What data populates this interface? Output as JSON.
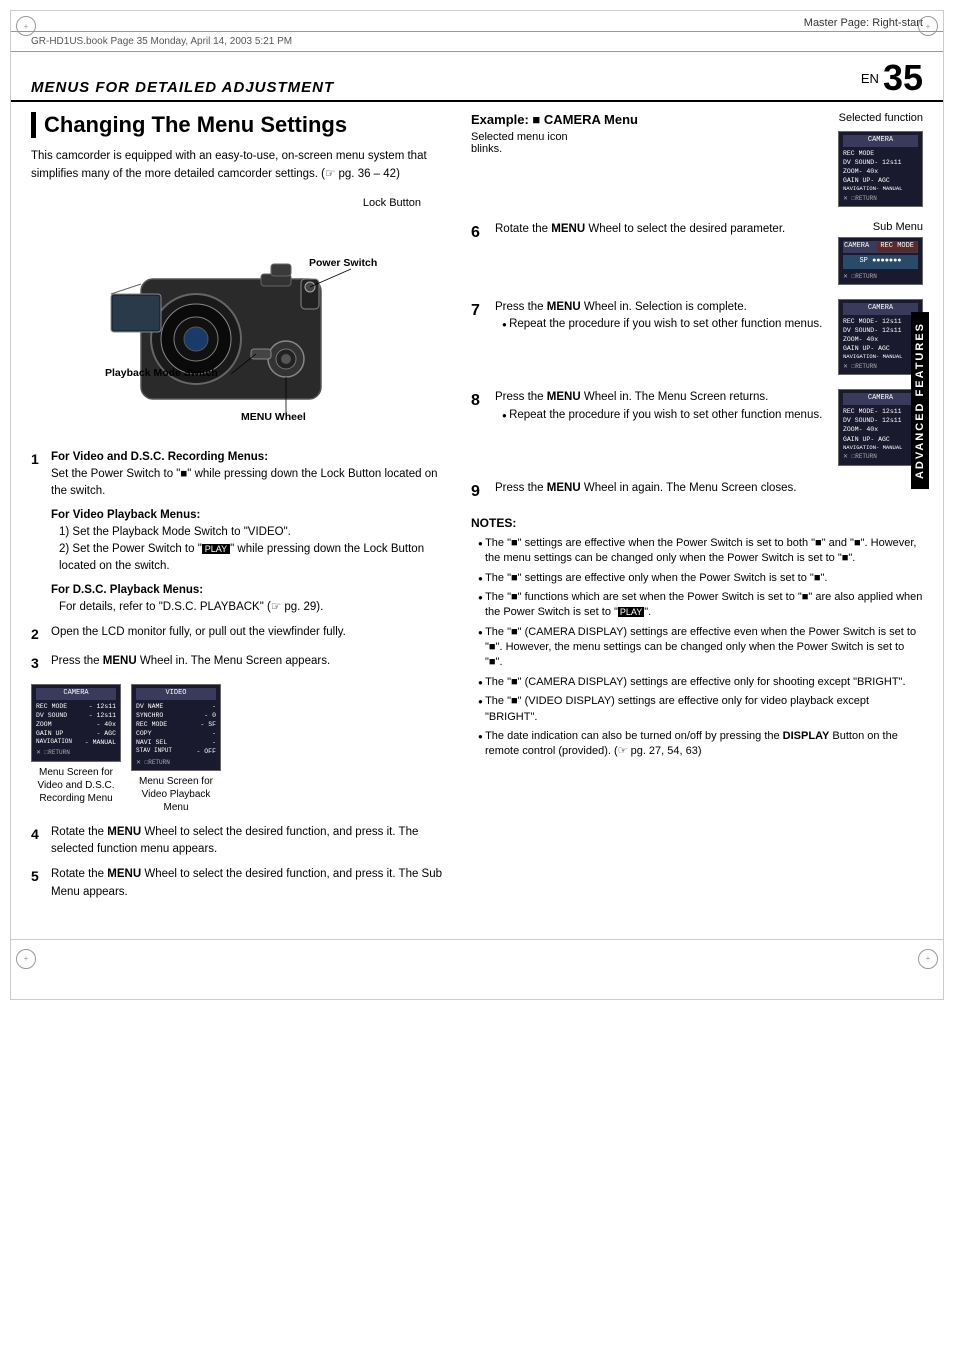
{
  "meta": {
    "master_page": "Master Page: Right-start",
    "file_info": "GR-HD1US.book  Page 35  Monday, April 14, 2003  5:21 PM"
  },
  "header": {
    "section_title": "MENUS FOR DETAILED ADJUSTMENT",
    "en_label": "EN",
    "page_number": "35"
  },
  "page": {
    "heading": "Changing The Menu Settings",
    "intro": "This camcorder is equipped with an easy-to-use, on-screen menu system that simplifies many of the more detailed camcorder settings. (☞ pg. 36 – 42)"
  },
  "camera_labels": {
    "lock_button": "Lock Button",
    "power_switch": "Power Switch",
    "playback_mode": "Playback Mode Switch",
    "menu_wheel": "MENU Wheel"
  },
  "steps": [
    {
      "num": "1",
      "title": "For Video and D.S.C. Recording Menus:",
      "text": "Set the Power Switch to \"\" while pressing down the Lock Button located on the switch.",
      "sub_steps": [
        {
          "title": "For Video Playback Menus:",
          "items": [
            "1) Set the Playback Mode Switch to \"VIDEO\".",
            "2) Set the Power Switch to \"PLAY\" while pressing down the Lock Button located on the switch."
          ]
        },
        {
          "title": "For D.S.C. Playback Menus:",
          "text": "For details, refer to \"D.S.C. PLAYBACK\" (☞ pg. 29)."
        }
      ]
    },
    {
      "num": "2",
      "text": "Open the LCD monitor fully, or pull out the viewfinder fully."
    },
    {
      "num": "3",
      "text": "Press the MENU Wheel in. The Menu Screen appears."
    },
    {
      "num": "4",
      "text": "Rotate the MENU Wheel to select the desired function, and press it. The selected function menu appears."
    },
    {
      "num": "5",
      "text": "Rotate the MENU Wheel to select the desired function, and press it. The Sub Menu appears."
    }
  ],
  "right_steps": [
    {
      "num": "6",
      "text": "Rotate the MENU Wheel to select the desired parameter."
    },
    {
      "num": "7",
      "text": "Press the MENU Wheel in. Selection is complete.",
      "bullets": [
        "Repeat the procedure if you wish to set other function menus."
      ]
    },
    {
      "num": "8",
      "text": "Press the MENU Wheel in. The Menu Screen returns.",
      "bullets": [
        "Repeat the procedure if you wish to set other function menus."
      ]
    },
    {
      "num": "9",
      "text": "Press the MENU Wheel in again. The Menu Screen closes."
    }
  ],
  "example": {
    "label": "Example: ■ CAMERA Menu",
    "selected_function_label": "Selected function",
    "selected_menu_icon_label": "Selected menu icon blinks.",
    "sub_menu_label": "Sub Menu"
  },
  "menu_screens": {
    "video_recording": {
      "header": "CAMERA",
      "rows": [
        "REC MODE  -  12s11",
        "DV SOUND  -  12s11",
        "ZOOM      -  40x",
        "GAIN UP   -  AGC",
        "NAVIGATION- MANUAL"
      ],
      "return": "X RETURN",
      "caption": "Menu Screen for Video and D.S.C. Recording Menu"
    },
    "video_playback": {
      "header": "VIDEO",
      "rows": [
        "DV NAME   -",
        "SYNCHRO   - 0",
        "REC MODE  - SF",
        "COPY      -",
        "NAVI SEL  -",
        "STAV INPUT- OFF"
      ],
      "return": "X RETURN",
      "caption": "Menu Screen for Video Playback Menu"
    }
  },
  "notes": {
    "title": "NOTES:",
    "items": [
      "The \"\" settings are effective when the Power Switch is set to both \"\" and \"\". However, the menu settings can be changed only when the Power Switch is set to \"\".",
      "The \"\" settings are effective only when the Power Switch is set to \"\".",
      "The \"\" functions which are set when the Power Switch is set to \"\" are also applied when the Power Switch is set to \"PLAY\".",
      "The \"\" (CAMERA DISPLAY) settings are effective even when the Power Switch is set to \"\". However, the menu settings can be changed only when the Power Switch is set to \"\".",
      "The \"\" (CAMERA DISPLAY) settings are effective only for shooting except \"BRIGHT\".",
      "The \"\" (VIDEO DISPLAY) settings are effective only for video playback except \"BRIGHT\".",
      "The date indication can also be turned on/off by pressing the DISPLAY Button on the remote control (provided). (☞ pg. 27, 54, 63)"
    ]
  },
  "sidebar_label": "ADVANCED FEATURES"
}
